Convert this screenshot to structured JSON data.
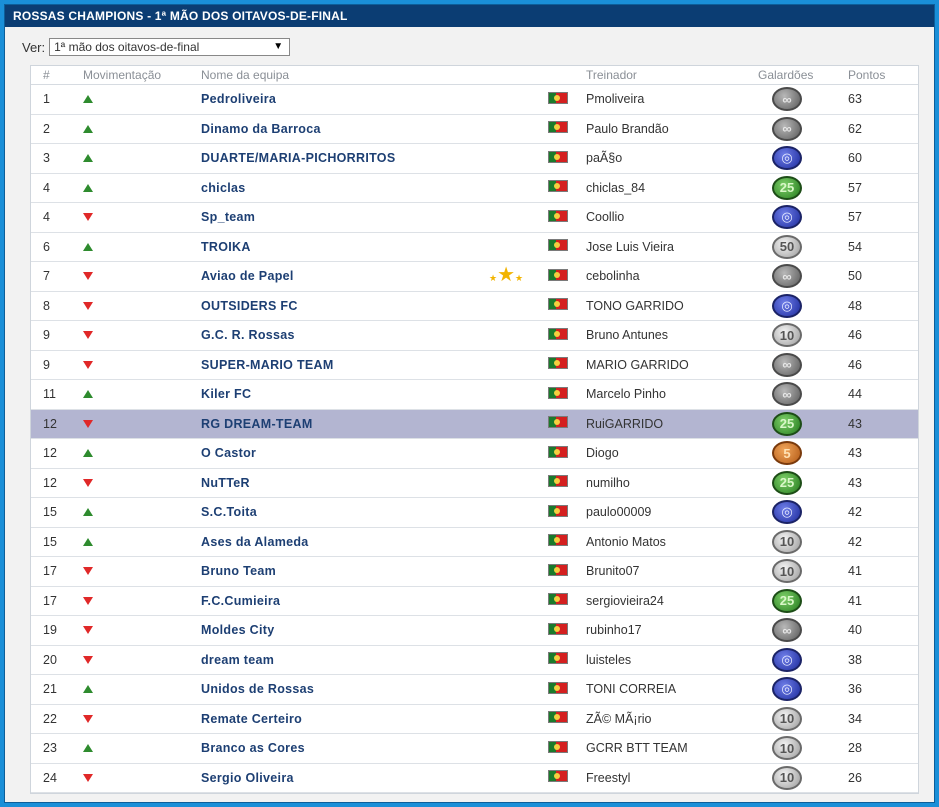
{
  "title": "ROSSAS CHAMPIONS - 1ª MÃO DOS OITAVOS-DE-FINAL",
  "filter": {
    "label": "Ver:",
    "selected": "1ª mão dos oitavos-de-final"
  },
  "columns": [
    "#",
    "Movimentação",
    "Nome da equipa",
    "Treinador",
    "Galardões",
    "Pontos"
  ],
  "rows": [
    {
      "rank": "1",
      "move": "up",
      "team": "Pedroliveira",
      "coach": "Pmoliveira",
      "medal": "gray",
      "medal_text": "∞",
      "points": "63"
    },
    {
      "rank": "2",
      "move": "up",
      "team": "Dinamo da Barroca",
      "coach": "Paulo Brandão",
      "medal": "gray",
      "medal_text": "∞",
      "points": "62"
    },
    {
      "rank": "3",
      "move": "up",
      "team": "DUARTE/MARIA-PICHORRITOS",
      "coach": "paÃ§o",
      "medal": "blue",
      "medal_text": "◎",
      "points": "60"
    },
    {
      "rank": "4",
      "move": "up",
      "team": "chiclas",
      "coach": "chiclas_84",
      "medal": "green",
      "medal_text": "25",
      "points": "57"
    },
    {
      "rank": "4",
      "move": "down",
      "team": "Sp_team",
      "coach": "Coollio",
      "medal": "blue",
      "medal_text": "◎",
      "points": "57"
    },
    {
      "rank": "6",
      "move": "up",
      "team": "TROIKA",
      "coach": "Jose Luis Vieira",
      "medal": "silver",
      "medal_text": "50",
      "points": "54"
    },
    {
      "rank": "7",
      "move": "down",
      "team": "Aviao de Papel",
      "coach": "cebolinha",
      "medal": "gray",
      "medal_text": "∞",
      "points": "50",
      "stars": true
    },
    {
      "rank": "8",
      "move": "down",
      "team": "OUTSIDERS FC",
      "coach": "TONO GARRIDO",
      "medal": "blue",
      "medal_text": "◎",
      "points": "48"
    },
    {
      "rank": "9",
      "move": "down",
      "team": "G.C. R. Rossas",
      "coach": "Bruno Antunes",
      "medal": "silver",
      "medal_text": "10",
      "points": "46"
    },
    {
      "rank": "9",
      "move": "down",
      "team": "SUPER-MARIO TEAM",
      "coach": "MARIO GARRIDO",
      "medal": "gray",
      "medal_text": "∞",
      "points": "46"
    },
    {
      "rank": "11",
      "move": "up",
      "team": "Kiler FC",
      "coach": "Marcelo Pinho",
      "medal": "gray",
      "medal_text": "∞",
      "points": "44"
    },
    {
      "rank": "12",
      "move": "down",
      "team": "RG DREAM-TEAM",
      "coach": "RuiGARRIDO",
      "medal": "green",
      "medal_text": "25",
      "points": "43",
      "highlight": true
    },
    {
      "rank": "12",
      "move": "up",
      "team": "O Castor",
      "coach": "Diogo",
      "medal": "bronze",
      "medal_text": "5",
      "points": "43"
    },
    {
      "rank": "12",
      "move": "down",
      "team": "NuTTeR",
      "coach": "numilho",
      "medal": "green",
      "medal_text": "25",
      "points": "43"
    },
    {
      "rank": "15",
      "move": "up",
      "team": "S.C.Toita",
      "coach": "paulo00009",
      "medal": "blue",
      "medal_text": "◎",
      "points": "42"
    },
    {
      "rank": "15",
      "move": "up",
      "team": "Ases da Alameda",
      "coach": "Antonio Matos",
      "medal": "silver",
      "medal_text": "10",
      "points": "42"
    },
    {
      "rank": "17",
      "move": "down",
      "team": "Bruno Team",
      "coach": "Brunito07",
      "medal": "silver",
      "medal_text": "10",
      "points": "41"
    },
    {
      "rank": "17",
      "move": "down",
      "team": "F.C.Cumieira",
      "coach": "sergiovieira24",
      "medal": "green",
      "medal_text": "25",
      "points": "41"
    },
    {
      "rank": "19",
      "move": "down",
      "team": "Moldes City",
      "coach": "rubinho17",
      "medal": "gray",
      "medal_text": "∞",
      "points": "40"
    },
    {
      "rank": "20",
      "move": "down",
      "team": "dream team",
      "coach": "luisteles",
      "medal": "blue",
      "medal_text": "◎",
      "points": "38"
    },
    {
      "rank": "21",
      "move": "up",
      "team": "Unidos de Rossas",
      "coach": "TONI CORREIA",
      "medal": "blue",
      "medal_text": "◎",
      "points": "36"
    },
    {
      "rank": "22",
      "move": "down",
      "team": "Remate Certeiro",
      "coach": "ZÃ© MÃ¡rio",
      "medal": "silver",
      "medal_text": "10",
      "points": "34"
    },
    {
      "rank": "23",
      "move": "up",
      "team": "Branco as Cores",
      "coach": "GCRR BTT TEAM",
      "medal": "silver",
      "medal_text": "10",
      "points": "28"
    },
    {
      "rank": "24",
      "move": "down",
      "team": "Sergio Oliveira",
      "coach": "Freestyl",
      "medal": "silver",
      "medal_text": "10",
      "points": "26"
    }
  ]
}
